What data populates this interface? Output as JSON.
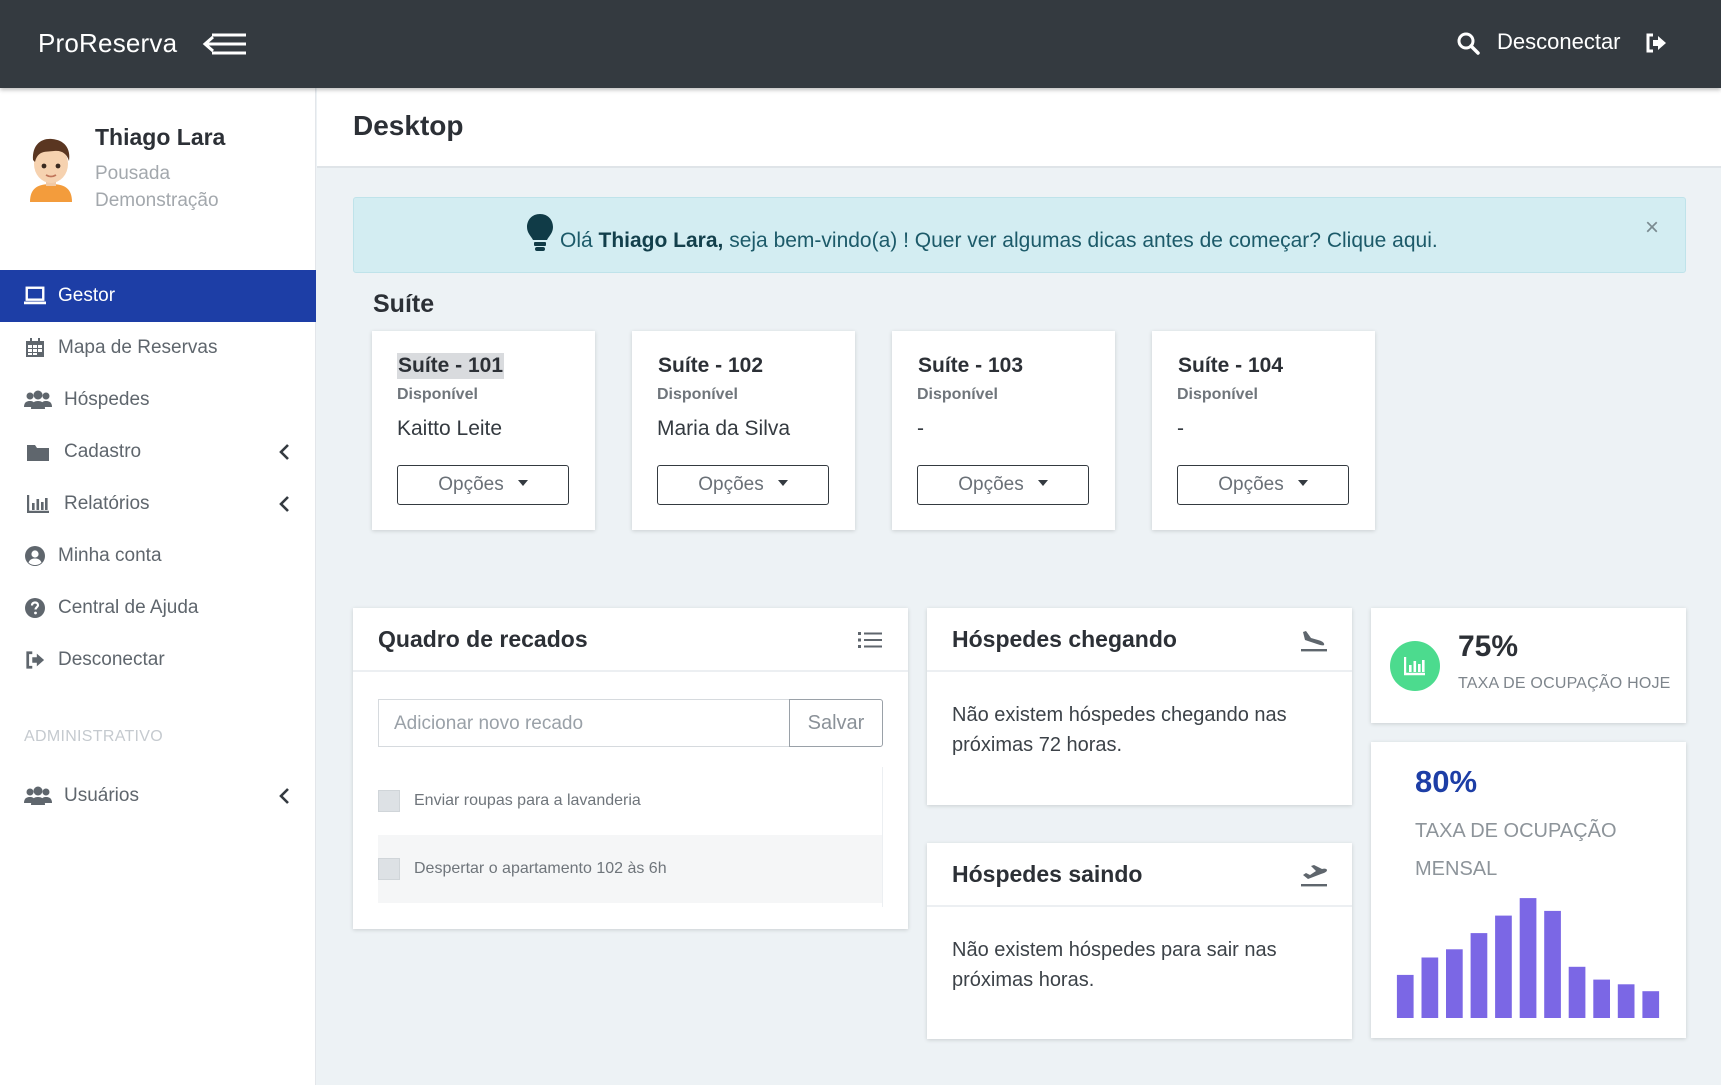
{
  "topbar": {
    "brand": "ProReserva",
    "logout_label": "Desconectar"
  },
  "user": {
    "name": "Thiago Lara",
    "subtitle": "Pousada Demonstração"
  },
  "sidebar": {
    "items": [
      {
        "label": "Gestor",
        "icon": "laptop-icon",
        "active": true
      },
      {
        "label": "Mapa de Reservas",
        "icon": "calendar-icon"
      },
      {
        "label": "Hóspedes",
        "icon": "users-icon"
      },
      {
        "label": "Cadastro",
        "icon": "folder-icon",
        "expandable": true
      },
      {
        "label": "Relatórios",
        "icon": "bar-chart-icon",
        "expandable": true
      },
      {
        "label": "Minha conta",
        "icon": "user-circle-icon"
      },
      {
        "label": "Central de Ajuda",
        "icon": "question-circle-icon"
      },
      {
        "label": "Desconectar",
        "icon": "sign-out-icon"
      }
    ],
    "admin_heading": "ADMINISTRATIVO",
    "admin_items": [
      {
        "label": "Usuários",
        "icon": "users-icon",
        "expandable": true
      }
    ]
  },
  "page": {
    "title": "Desktop"
  },
  "alert": {
    "prefix": "Olá ",
    "name": "Thiago Lara,",
    "message": " seja bem-vindo(a) ! Quer ver algumas dicas antes de começar? Clique aqui.",
    "close": "×"
  },
  "suites": {
    "heading": "Suíte",
    "rooms": [
      {
        "title": "Suíte - 101",
        "status": "Disponível",
        "guest": "Kaitto Leite",
        "button": "Opções"
      },
      {
        "title": "Suíte - 102",
        "status": "Disponível",
        "guest": "Maria da Silva",
        "button": "Opções"
      },
      {
        "title": "Suíte - 103",
        "status": "Disponível",
        "guest": "-",
        "button": "Opções"
      },
      {
        "title": "Suíte - 104",
        "status": "Disponível",
        "guest": "-",
        "button": "Opções"
      }
    ]
  },
  "notes": {
    "title": "Quadro de recados",
    "input_placeholder": "Adicionar novo recado",
    "save_label": "Salvar",
    "items": [
      "Enviar roupas para a lavanderia",
      "Despertar o apartamento 102 às 6h"
    ]
  },
  "arrivals": {
    "title": "Hóspedes chegando",
    "message": "Não existem hóspedes chegando nas próximas 72 horas."
  },
  "departures": {
    "title": "Hóspedes saindo",
    "message": "Não existem hóspedes para sair nas próximas horas."
  },
  "occupancy_today": {
    "value": "75%",
    "label": "TAXA DE OCUPAÇÃO HOJE",
    "color": "#4cdb8e"
  },
  "occupancy_monthly": {
    "value": "80%",
    "label": "TAXA DE OCUPAÇÃO MENSAL",
    "color": "#1d3ea6"
  },
  "chart_data": {
    "type": "bar",
    "values": [
      37,
      52,
      59,
      73,
      88,
      103,
      92,
      44,
      33,
      29,
      23
    ],
    "ylim": [
      0,
      110
    ],
    "color": "#7b67e5"
  },
  "colors": {
    "topbar": "#343a40",
    "active_menu": "#1d3ea6",
    "alert_bg": "#d3edf2"
  }
}
